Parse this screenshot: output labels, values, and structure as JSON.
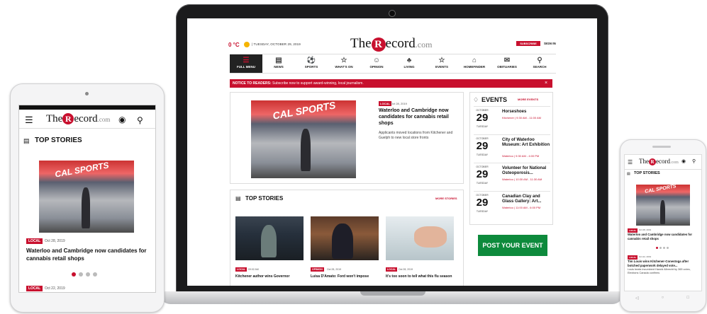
{
  "site": {
    "logo_the": "The",
    "logo_r": "R",
    "logo_rest": "ecord",
    "logo_com": ".com",
    "brand_color": "#c8102e"
  },
  "laptop": {
    "temperature": "0 °C",
    "date": "| TUESDAY, OCTOBER 29, 2019",
    "subscribe": "SUBSCRIBE",
    "sign_in": "SIGN IN",
    "nav": [
      {
        "label": "FULL MENU",
        "icon": "menu-icon",
        "glyph": "☰"
      },
      {
        "label": "NEWS",
        "icon": "news-icon",
        "glyph": "▤"
      },
      {
        "label": "SPORTS",
        "icon": "sports-icon",
        "glyph": "⚽"
      },
      {
        "label": "WHAT'S ON",
        "icon": "star-icon",
        "glyph": "☆"
      },
      {
        "label": "OPINION",
        "icon": "opinion-icon",
        "glyph": "☺"
      },
      {
        "label": "LIVING",
        "icon": "living-icon",
        "glyph": "♣"
      },
      {
        "label": "EVENTS",
        "icon": "events-icon",
        "glyph": "☆"
      },
      {
        "label": "HOMEFINDER",
        "icon": "homefinder-icon",
        "glyph": "⌂"
      },
      {
        "label": "OBITUARIES",
        "icon": "obituaries-icon",
        "glyph": "✉"
      },
      {
        "label": "SEARCH",
        "icon": "search-icon",
        "glyph": "⚲"
      }
    ],
    "notice_bold": "NOTICE TO READERS:",
    "notice_text": " Subscribe now to support award-winning, local journalism.",
    "notice_close": "×",
    "lead": {
      "badge": "LOCAL",
      "date": "Oct 28, 2019",
      "headline": "Waterloo and Cambridge now candidates for cannabis retail shops",
      "summary": "Applicants moved locations from Kitchener and Guelph to new local store fronts"
    },
    "events": {
      "title": "EVENTS",
      "more": "MORE EVENTS",
      "items": [
        {
          "month": "OCTOBER",
          "day": "29",
          "dow": "TUESDAY",
          "title": "Horseshoes",
          "meta": "Kitchener | 9:30 AM - 11:00 AM"
        },
        {
          "month": "OCTOBER",
          "day": "29",
          "dow": "TUESDAY",
          "title": "City of Waterloo Museum: Art Exhibition",
          "meta": "Waterloo | 9:30 AM - 4:00 PM"
        },
        {
          "month": "OCTOBER",
          "day": "29",
          "dow": "TUESDAY",
          "title": "Volunteer for National Osteoporosis...",
          "meta": "Waterloo | 10:30 AM - 11:30 AM"
        },
        {
          "month": "OCTOBER",
          "day": "29",
          "dow": "TUESDAY",
          "title": "Canadian Clay and Glass Gallery: Art...",
          "meta": "Waterloo | 11:00 AM - 6:00 PM"
        }
      ],
      "post_button": "POST YOUR EVENT"
    },
    "top_stories": {
      "title": "TOP STORIES",
      "more": "MORE STORIES",
      "cards": [
        {
          "badge": "LOCAL",
          "date": "09:02 AM",
          "headline": "Kitchener author wins Governor"
        },
        {
          "badge": "OPINION",
          "date": "Oct 28, 2019",
          "headline": "Luisa D'Amato: Ford won't impose"
        },
        {
          "badge": "LOCAL",
          "date": "Oct 28, 2019",
          "headline": "It's too soon to tell what this flu season"
        }
      ]
    }
  },
  "tablet": {
    "section": "TOP STORIES",
    "badge": "LOCAL",
    "date": "Oct 28, 2019",
    "headline": "Waterloo and Cambridge now candidates for cannabis retail shops",
    "badge2": "LOCAL",
    "date2": "Oct 22, 2019"
  },
  "phone": {
    "section": "TOP STORIES",
    "badge": "LOCAL",
    "date": "Oct 28, 2019",
    "headline": "Waterloo and Cambridge now candidates for cannabis retail shops",
    "badge2": "LOCAL",
    "date2": "Oct 22, 2019",
    "headline2": "Tim Louis wins Kitchener-Conestoga after botched paperwork delayed vote...",
    "summary2": "Louis beats incumbent Harold Albrecht by 365 votes, Elections Canada confirms"
  },
  "photo_sign": "CAL SPORTS"
}
